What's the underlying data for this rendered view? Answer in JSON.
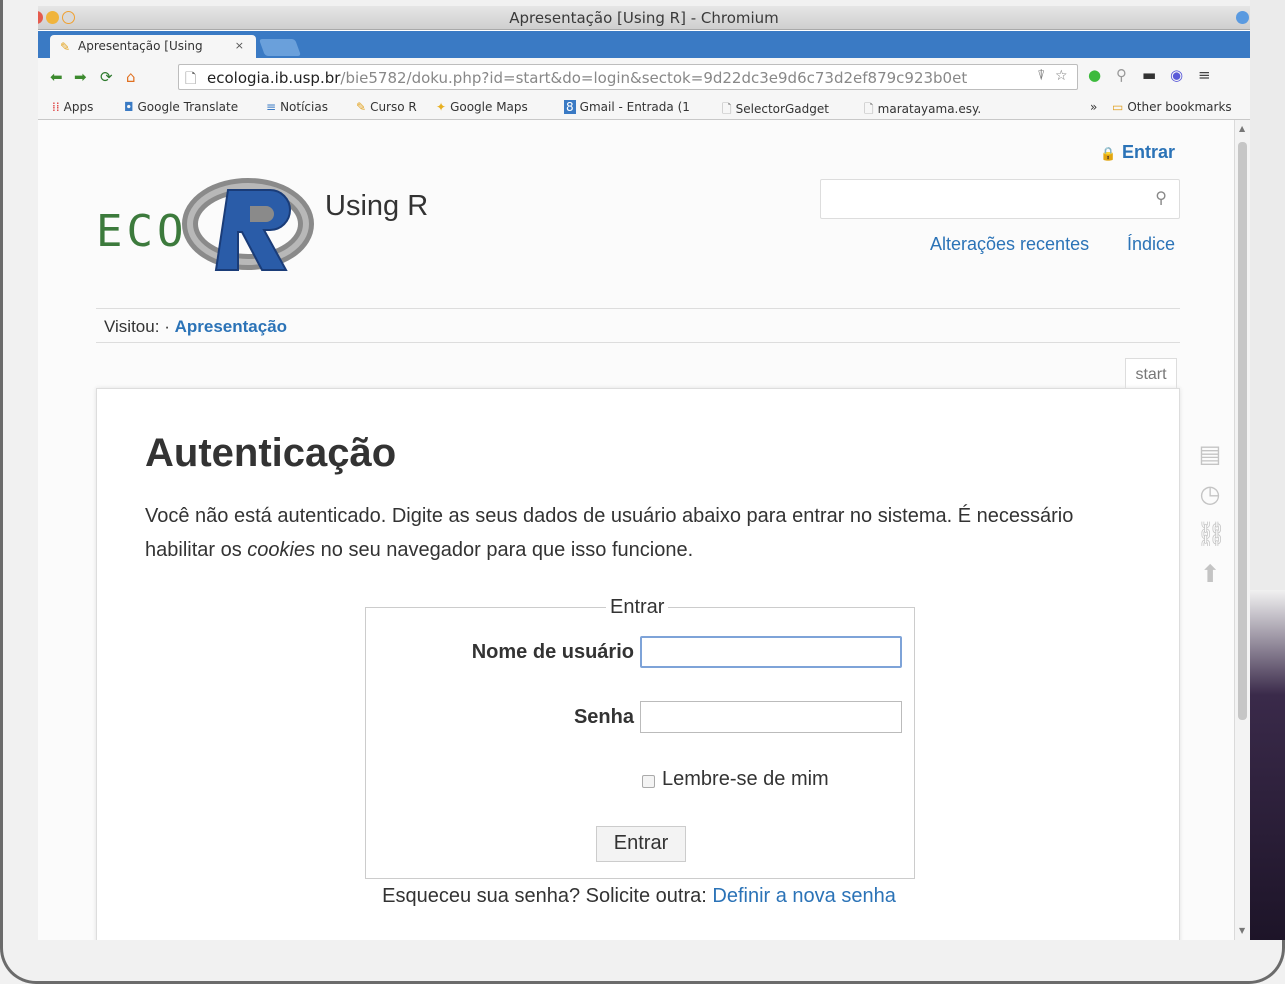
{
  "window": {
    "title": "Apresentação [Using R] - Chromium"
  },
  "tabs": [
    {
      "label": "Apresentação [Using",
      "close": "×"
    }
  ],
  "toolbar": {
    "url_host": "ecologia.ib.usp.br",
    "url_rest": "/bie5782/doku.php?id=start&do=login&sectok=9d22dc3e9d6c73d2ef879c923b0et"
  },
  "bookmarks": {
    "items": [
      {
        "label": "Apps",
        "icon": "apps-grid-icon"
      },
      {
        "label": "Google Translate",
        "icon": "translate-icon"
      },
      {
        "label": "Notícias",
        "icon": "news-icon"
      },
      {
        "label": "Curso R",
        "icon": "curso-r-icon"
      },
      {
        "label": "Google Maps",
        "icon": "maps-icon"
      },
      {
        "label": "Gmail - Entrada (1",
        "icon": "gmail-icon"
      },
      {
        "label": "SelectorGadget",
        "icon": "page-icon"
      },
      {
        "label": "maratayama.esy.",
        "icon": "page-icon"
      }
    ],
    "overflow": "»",
    "other": "Other bookmarks"
  },
  "site": {
    "login_link": "Entrar",
    "logo_text": "ECO",
    "title": "Using R",
    "search_placeholder": "",
    "nav": {
      "recent": "Alterações recentes",
      "index": "Índice"
    },
    "breadcrumb": {
      "prefix": "Visitou:",
      "sep": "·",
      "page": "Apresentação"
    },
    "page_id": "start"
  },
  "page": {
    "heading": "Autenticação",
    "intro_a": "Você não está autenticado. Digite as seus dados de usuário abaixo para entrar no sistema. É necessário habilitar os ",
    "intro_em": "cookies",
    "intro_b": " no seu navegador para que isso funcione.",
    "form": {
      "legend": "Entrar",
      "username_label": "Nome de usuário",
      "username_value": "",
      "password_label": "Senha",
      "password_value": "",
      "remember_label": "Lembre-se de mim",
      "remember_checked": false,
      "submit": "Entrar"
    },
    "forgot_text": "Esqueceu sua senha? Solicite outra:",
    "forgot_link": "Definir a nova senha"
  },
  "colors": {
    "link": "#2b73b7",
    "tabstrip": "#3a7ac4",
    "logo_green": "#3c7a3c"
  }
}
